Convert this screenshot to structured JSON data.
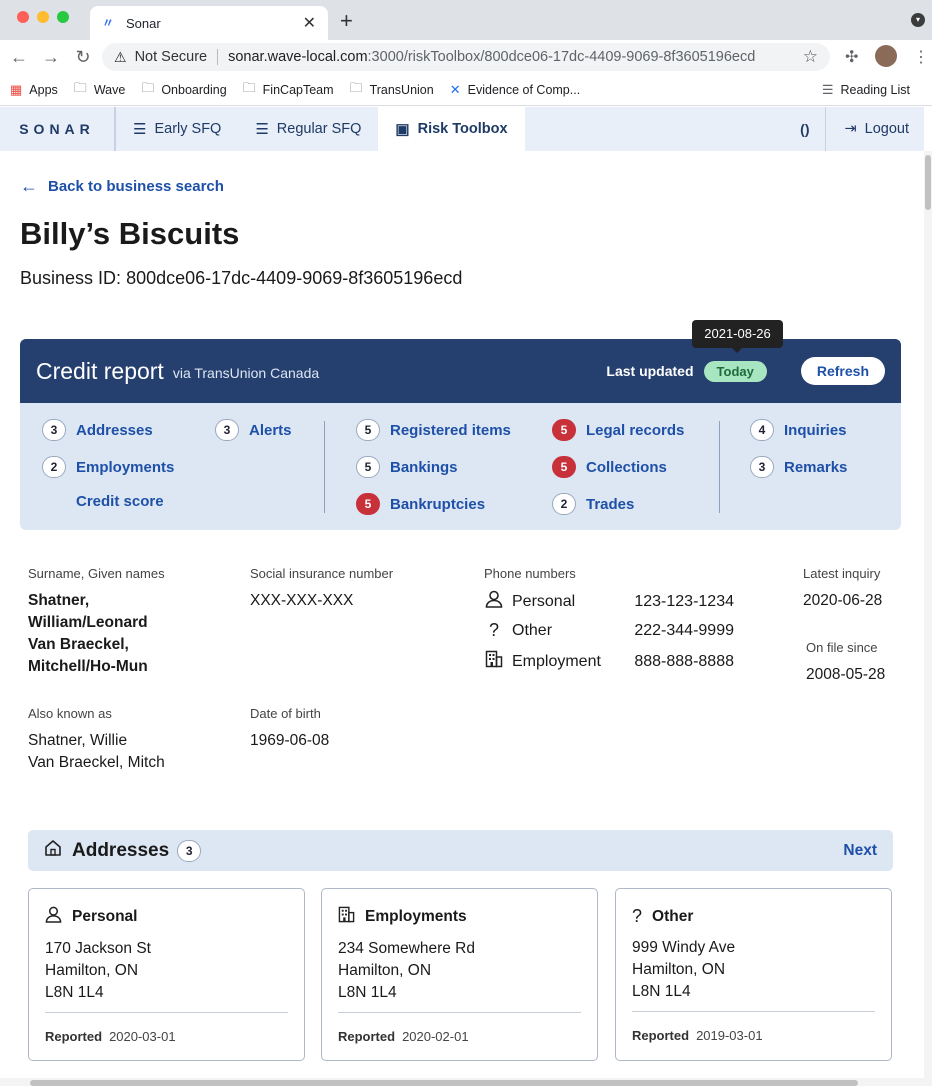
{
  "browser": {
    "tab_title": "Sonar",
    "not_secure": "Not Secure",
    "url_host": "sonar.wave-local.com",
    "url_path": ":3000/riskToolbox/800dce06-17dc-4409-9069-8f3605196ecd",
    "bookmarks": [
      "Apps",
      "Wave",
      "Onboarding",
      "FinCapTeam",
      "TransUnion",
      "Evidence of Comp..."
    ],
    "reading_list": "Reading List"
  },
  "nav": {
    "logo": "SONAR",
    "items": [
      {
        "label": "Early SFQ",
        "active": false
      },
      {
        "label": "Regular SFQ",
        "active": false
      },
      {
        "label": "Risk Toolbox",
        "active": true
      }
    ],
    "paren": "()",
    "logout": "Logout"
  },
  "page": {
    "back_link": "Back to business search",
    "business_name": "Billy’s Biscuits",
    "business_id_label": "Business ID:",
    "business_id": "800dce06-17dc-4409-9069-8f3605196ecd"
  },
  "credit_report": {
    "title": "Credit report",
    "via": "via TransUnion Canada",
    "last_updated_label": "Last updated",
    "last_updated_value": "Today",
    "tooltip": "2021-08-26",
    "refresh": "Refresh",
    "categories": [
      {
        "label": "Addresses",
        "count": "3",
        "alert": false
      },
      {
        "label": "Employments",
        "count": "2",
        "alert": false
      },
      {
        "label": "Credit score",
        "count": "",
        "alert": false
      },
      {
        "label": "Alerts",
        "count": "3",
        "alert": false
      },
      {
        "label": "Registered items",
        "count": "5",
        "alert": false
      },
      {
        "label": "Bankings",
        "count": "5",
        "alert": false
      },
      {
        "label": "Bankruptcies",
        "count": "5",
        "alert": true
      },
      {
        "label": "Legal records",
        "count": "5",
        "alert": true
      },
      {
        "label": "Collections",
        "count": "5",
        "alert": true
      },
      {
        "label": "Trades",
        "count": "2",
        "alert": false
      },
      {
        "label": "Inquiries",
        "count": "4",
        "alert": false
      },
      {
        "label": "Remarks",
        "count": "3",
        "alert": false
      }
    ]
  },
  "person": {
    "names_label": "Surname, Given names",
    "names": [
      "Shatner,",
      "William/Leonard",
      "Van Braeckel,",
      "Mitchell/Ho-Mun"
    ],
    "sin_label": "Social insurance number",
    "sin": "XXX-XXX-XXX",
    "phones_label": "Phone numbers",
    "phones": [
      {
        "type": "Personal",
        "icon": "person-icon",
        "number": "123-123-1234"
      },
      {
        "type": "Other",
        "icon": "question-icon",
        "number": "222-344-9999"
      },
      {
        "type": "Employment",
        "icon": "building-icon",
        "number": "888-888-8888"
      }
    ],
    "latest_inquiry_label": "Latest inquiry",
    "latest_inquiry": "2020-06-28",
    "on_file_label": "On file since",
    "on_file": "2008-05-28",
    "aka_label": "Also known as",
    "aka": [
      "Shatner, Willie",
      "Van Braeckel, Mitch"
    ],
    "dob_label": "Date of birth",
    "dob": "1969-06-08"
  },
  "addresses": {
    "title": "Addresses",
    "count": "3",
    "next": "Next",
    "cards": [
      {
        "type": "Personal",
        "icon": "person-icon",
        "lines": [
          "170 Jackson St",
          "Hamilton, ON",
          "L8N 1L4"
        ],
        "reported_label": "Reported",
        "reported": "2020-03-01"
      },
      {
        "type": "Employments",
        "icon": "building-icon",
        "lines": [
          "234 Somewhere Rd",
          "Hamilton, ON",
          "L8N 1L4"
        ],
        "reported_label": "Reported",
        "reported": "2020-02-01"
      },
      {
        "type": "Other",
        "icon": "question-icon",
        "lines": [
          "999 Windy Ave",
          "Hamilton, ON",
          "L8N 1L4"
        ],
        "reported_label": "Reported",
        "reported": "2019-03-01"
      }
    ]
  },
  "colors": {
    "primary": "#253f6e",
    "link": "#1e50a8",
    "alert": "#c8303a",
    "today_bg": "#a8e6c1"
  }
}
